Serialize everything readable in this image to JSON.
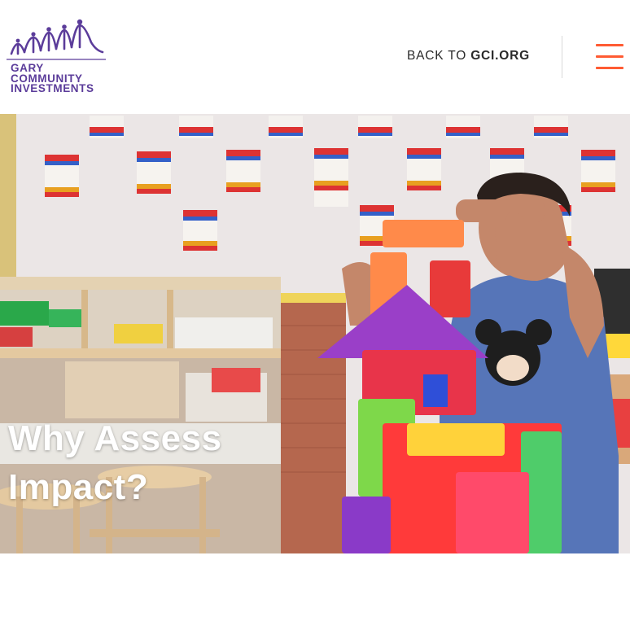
{
  "header": {
    "logo": {
      "line1": "GARY",
      "line2": "COMMUNITY",
      "line3": "INVESTMENTS",
      "icon": "people-arch-logo-icon",
      "color": "#5b3c9a"
    },
    "back_link": {
      "prefix": "BACK TO ",
      "site": "GCI.ORG"
    },
    "menu": {
      "icon": "hamburger-menu-icon",
      "color": "#ff5b33"
    }
  },
  "hero": {
    "title_line1": "Why Assess",
    "title_line2": "Impact?",
    "image": "child-building-colorful-block-tower-photo"
  }
}
